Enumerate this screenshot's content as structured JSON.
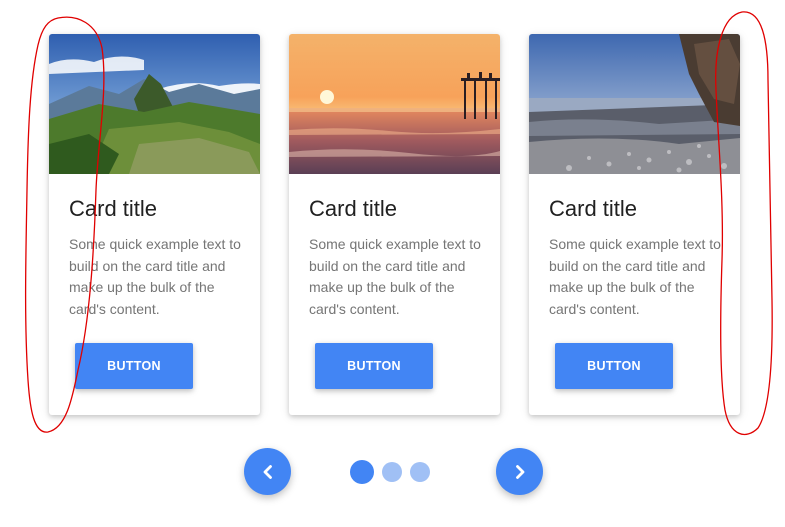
{
  "cards": [
    {
      "title": "Card title",
      "text": "Some quick example text to build on the card title and make up the bulk of the card's content.",
      "button": "BUTTON",
      "image": "mountain-ruins-photo"
    },
    {
      "title": "Card title",
      "text": "Some quick example text to build on the card title and make up the bulk of the card's content.",
      "button": "BUTTON",
      "image": "sunset-pier-photo"
    },
    {
      "title": "Card title",
      "text": "Some quick example text to build on the card title and make up the bulk of the card's content.",
      "button": "BUTTON",
      "image": "rocky-beach-photo"
    }
  ],
  "carousel": {
    "prev_icon": "chevron-left-icon",
    "next_icon": "chevron-right-icon",
    "active_index": 0,
    "indicator_count": 3
  },
  "colors": {
    "accent": "#4285f4",
    "indicator_active": "#4285f4",
    "indicator_inactive": "#a0c0f5",
    "annotation": "#e00000"
  }
}
